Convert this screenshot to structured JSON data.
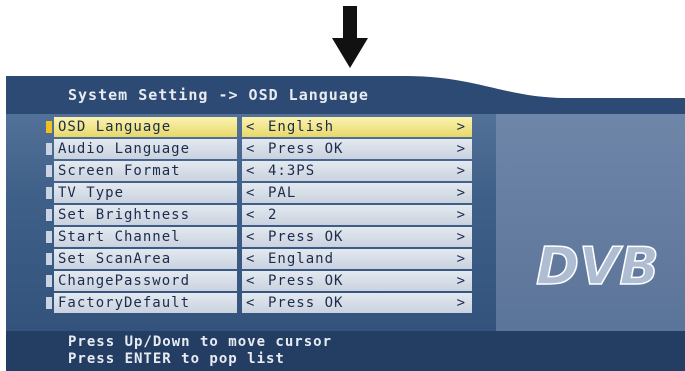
{
  "title": "System Setting -> OSD Language",
  "logo_text": "DVB",
  "menu": [
    {
      "label": "OSD Language",
      "value": "English",
      "selected": true
    },
    {
      "label": "Audio Language",
      "value": "Press OK",
      "selected": false
    },
    {
      "label": "Screen Format",
      "value": "4:3PS",
      "selected": false
    },
    {
      "label": "TV Type",
      "value": "PAL",
      "selected": false
    },
    {
      "label": "Set Brightness",
      "value": "2",
      "selected": false
    },
    {
      "label": "Start Channel",
      "value": "Press OK",
      "selected": false
    },
    {
      "label": "Set ScanArea",
      "value": "England",
      "selected": false
    },
    {
      "label": "ChangePassword",
      "value": "Press OK",
      "selected": false
    },
    {
      "label": "FactoryDefault",
      "value": "Press OK",
      "selected": false
    }
  ],
  "arrows": {
    "left": "<",
    "right": ">"
  },
  "help": {
    "line1": "Press Up/Down to move cursor",
    "line2": "Press ENTER to pop list"
  },
  "colors": {
    "selected_row": "#f0dc70",
    "row": "#d6dde8",
    "screen_bg": "#3f6088",
    "help_bar": "#243e63"
  },
  "icons": {
    "pointer": "down-arrow-icon"
  }
}
